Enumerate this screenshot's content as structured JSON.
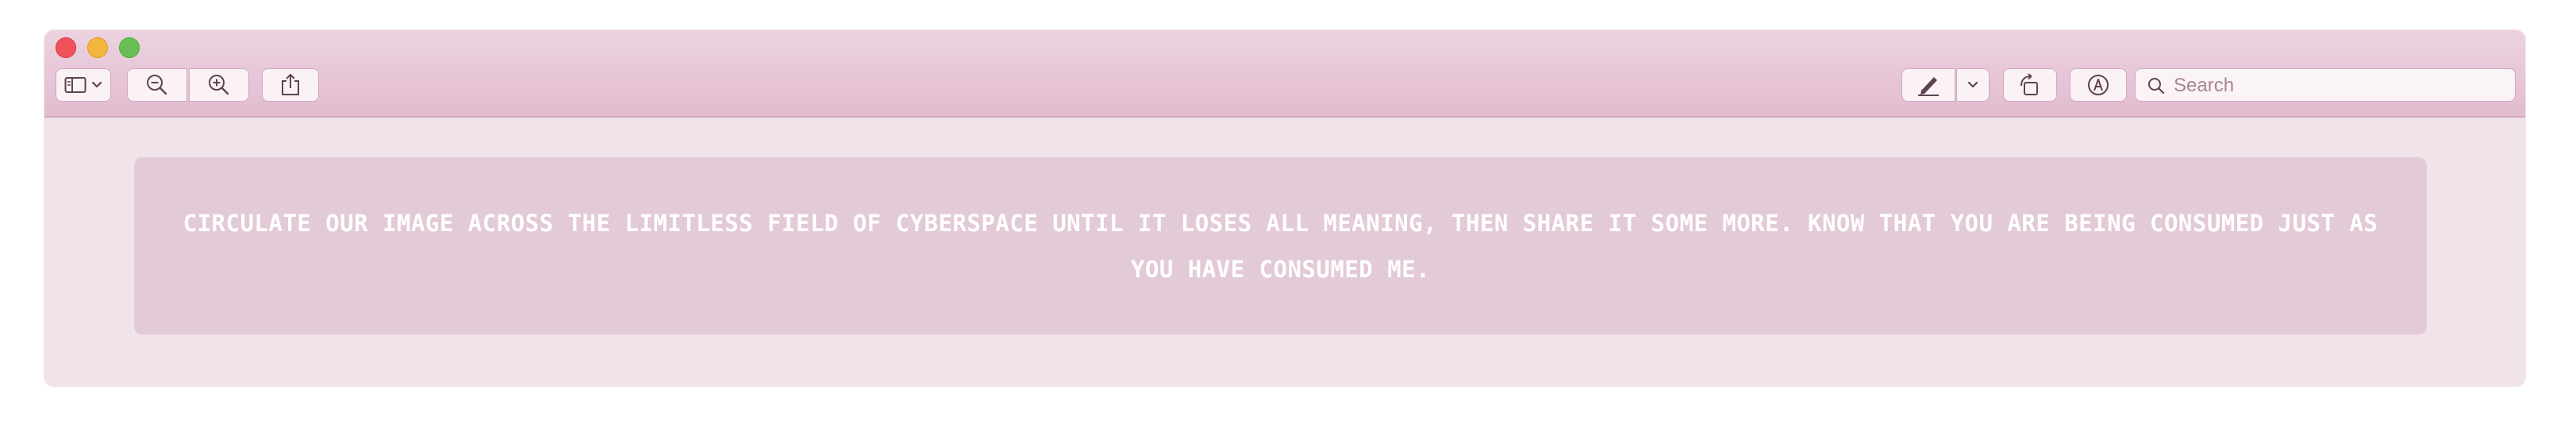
{
  "window": {
    "title": "",
    "controls": [
      "close",
      "minimize",
      "zoom"
    ]
  },
  "toolbar": {
    "left_icons": [
      "sidebar-icon",
      "chevron-down-icon",
      "zoom-out-icon",
      "zoom-in-icon",
      "share-icon"
    ],
    "right_icons": [
      "markup-pen-icon",
      "chevron-down-icon",
      "rotate-icon",
      "annotate-icon"
    ],
    "search": {
      "placeholder": "Search",
      "value": ""
    }
  },
  "document": {
    "text": "CIRCULATE OUR IMAGE ACROSS THE LIMITLESS FIELD OF CYBERSPACE UNTIL IT LOSES ALL MEANING, THEN SHARE IT SOME MORE. KNOW THAT YOU ARE BEING CONSUMED JUST AS YOU HAVE CONSUMED ME."
  },
  "colors": {
    "titlebar_top": "#ecd3e0",
    "titlebar_bottom": "#e2bbcf",
    "content_bg": "#f1e3ea",
    "card_bg": "#e3cad7",
    "text": "#ffffff"
  }
}
